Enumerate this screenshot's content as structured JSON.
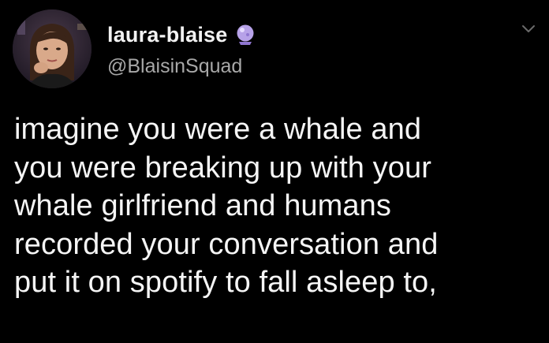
{
  "tweet": {
    "display_name": "laura-blaise",
    "handle": "@BlaisinSquad",
    "badge_icon": "crystal-ball-icon",
    "menu_icon": "chevron-down-icon",
    "text_lines": [
      "imagine you were a whale and",
      "you were breaking up with your",
      "whale girlfriend and humans",
      "recorded your conversation and",
      "put it on spotify to fall asleep to,"
    ]
  },
  "colors": {
    "background": "#000000",
    "name": "#f2f2f2",
    "handle": "#a8a8a8",
    "body_text": "#f5f5f5",
    "badge": "#b7a2e8"
  }
}
